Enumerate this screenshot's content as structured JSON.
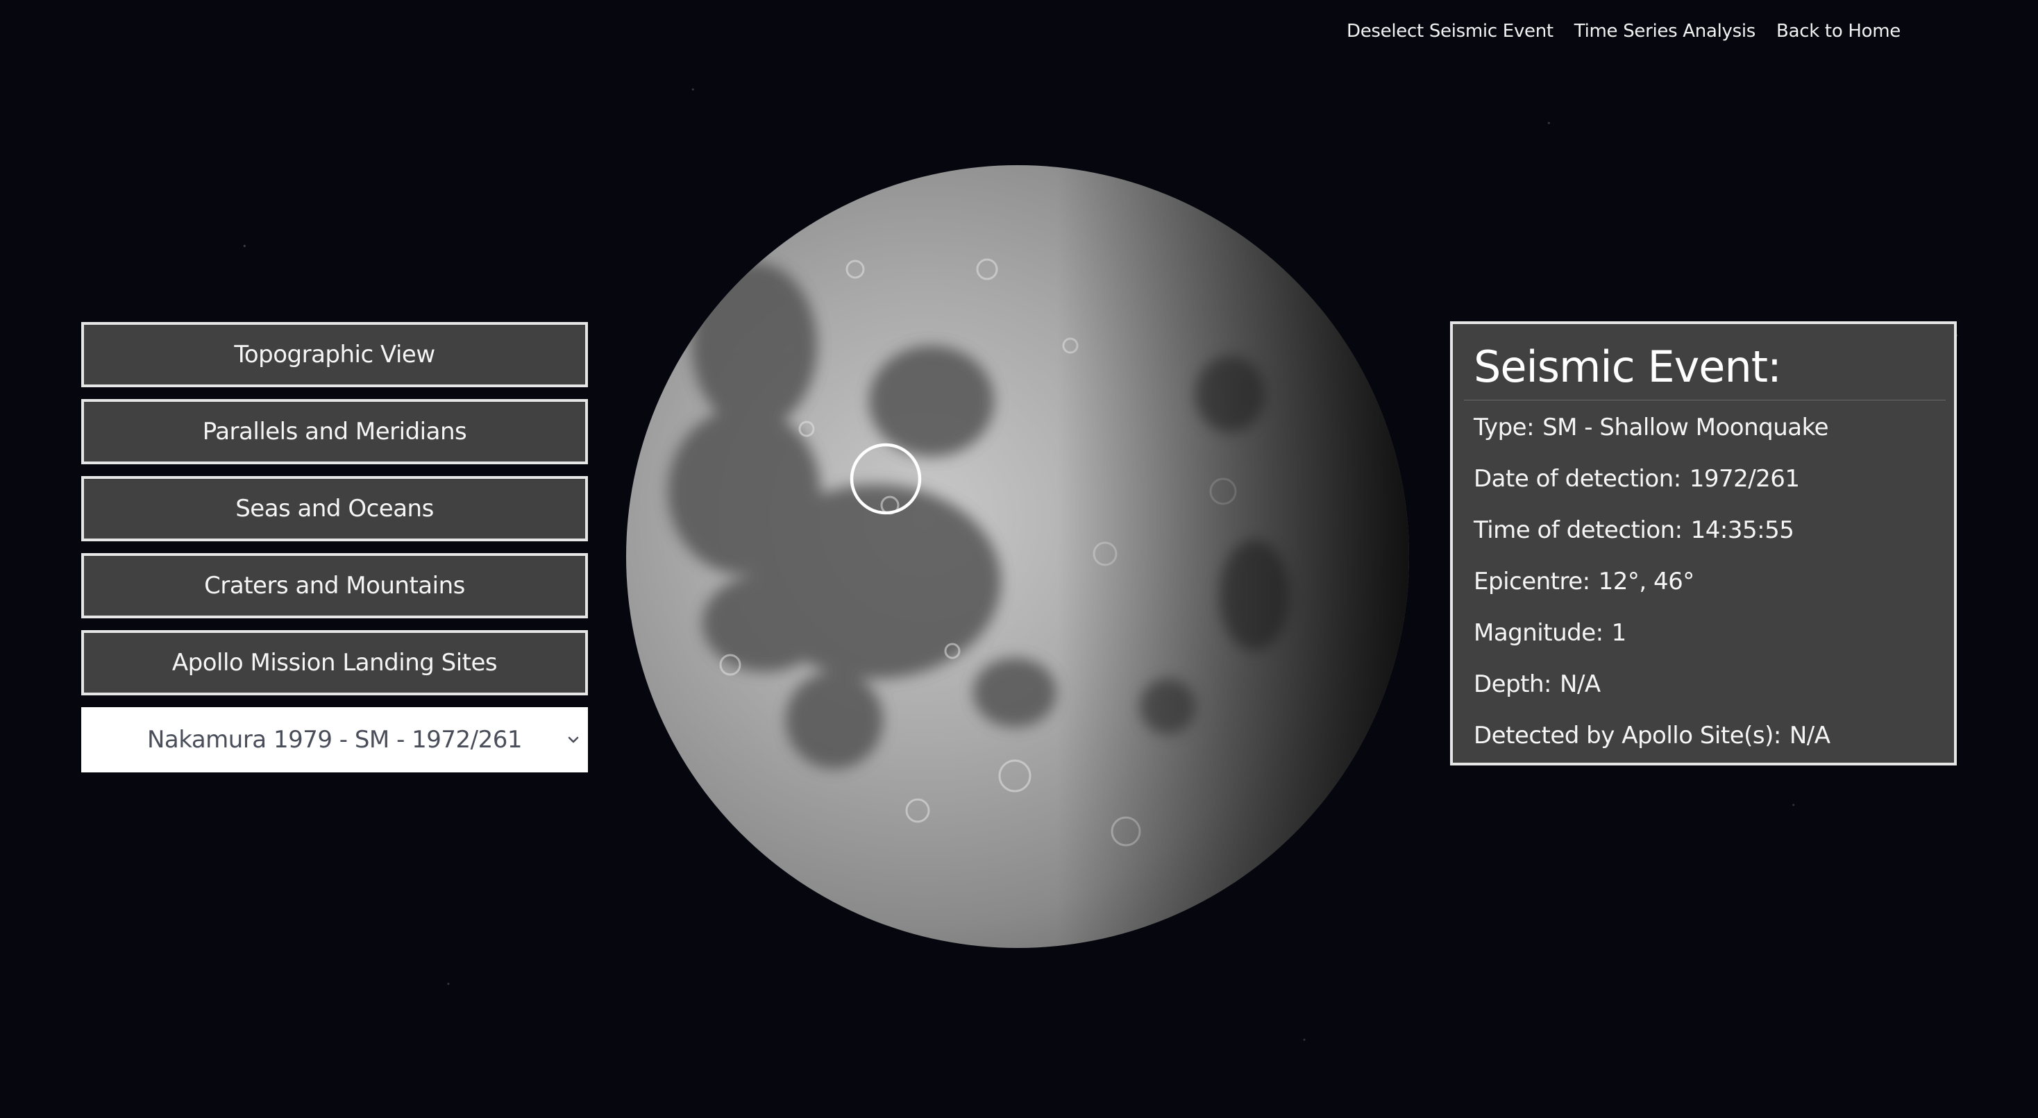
{
  "nav": {
    "deselect": "Deselect Seismic Event",
    "time_series": "Time Series Analysis",
    "home": "Back to Home"
  },
  "menu": {
    "items": [
      {
        "label": "Topographic View",
        "name": "topographic-view-button"
      },
      {
        "label": "Parallels and Meridians",
        "name": "parallels-meridians-button"
      },
      {
        "label": "Seas and Oceans",
        "name": "seas-oceans-button"
      },
      {
        "label": "Craters and Mountains",
        "name": "craters-mountains-button"
      },
      {
        "label": "Apollo Mission Landing Sites",
        "name": "apollo-landing-sites-button"
      }
    ],
    "event_select": {
      "value": "Nakamura 1979 - SM - 1972/261",
      "icon": "chevron-down-icon"
    }
  },
  "event": {
    "title": "Seismic Event:",
    "type_label": "Type:",
    "type_value": "SM - Shallow Moonquake",
    "date_label": "Date of detection:",
    "date_value": "1972/261",
    "time_label": "Time of detection:",
    "time_value": "14:35:55",
    "epicentre_label": "Epicentre:",
    "epicentre_value": "12°, 46°",
    "magnitude_label": "Magnitude:",
    "magnitude_value": "1",
    "depth_label": "Depth:",
    "depth_value": "N/A",
    "detected_label": "Detected by Apollo Site(s):",
    "detected_value": "N/A"
  },
  "colors": {
    "background": "#06070e",
    "panel": "#414141",
    "panel_border": "#e6e6e6",
    "select_bg": "#ffffff",
    "select_text": "#4a4e5a"
  }
}
